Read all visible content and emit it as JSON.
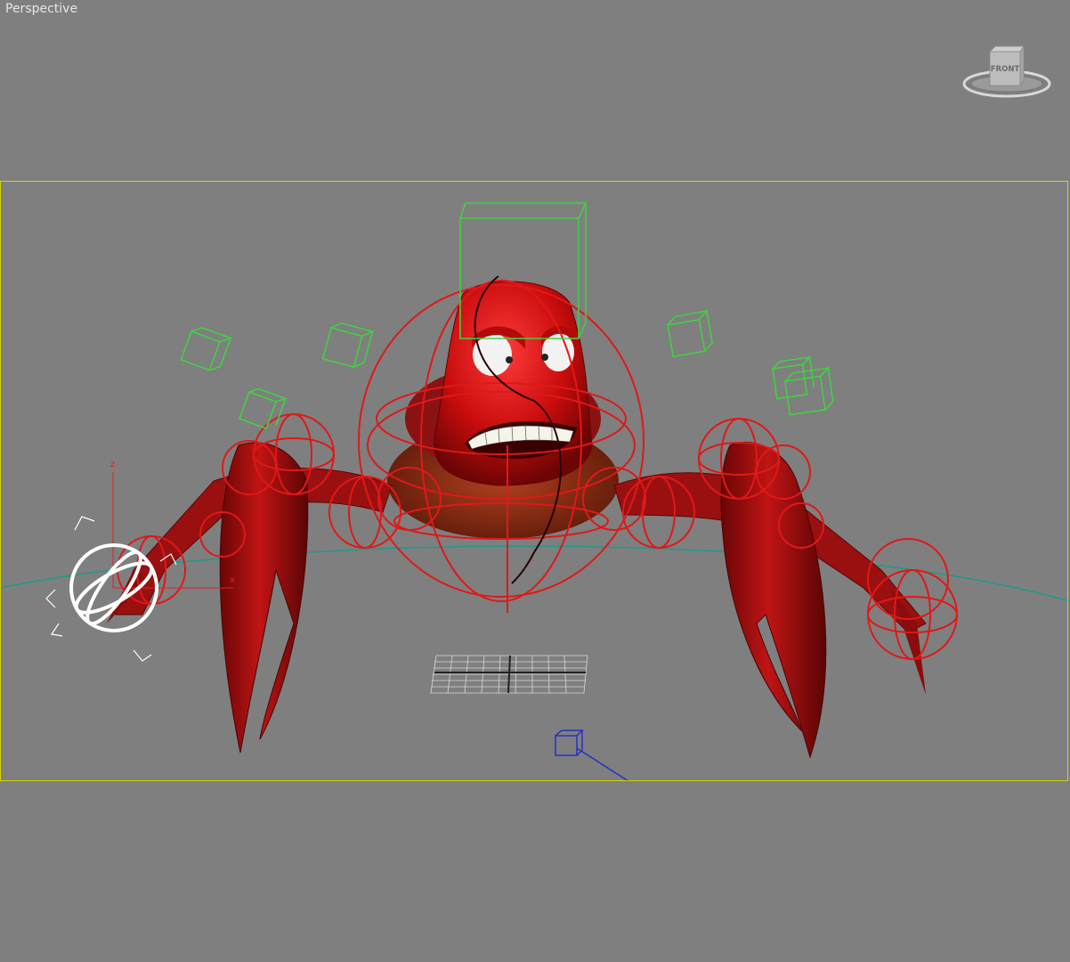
{
  "viewport": {
    "label": "Perspective",
    "view_cube_face": "FRONT",
    "background_color": "#7f7f7f",
    "safe_frame_color": "#d8d400"
  },
  "gizmo": {
    "axis_z": "z",
    "axis_x": "x"
  },
  "scene_colors": {
    "character_red": "#c21010",
    "rig_wire_red": "#e01818",
    "helper_green": "#3fd43f",
    "camera_blue": "#2430c8",
    "ground_teal": "#1d9a8a"
  },
  "icons": [
    "view-cube-icon",
    "transform-gizmo-icon",
    "camera-icon",
    "grid-object-icon"
  ]
}
